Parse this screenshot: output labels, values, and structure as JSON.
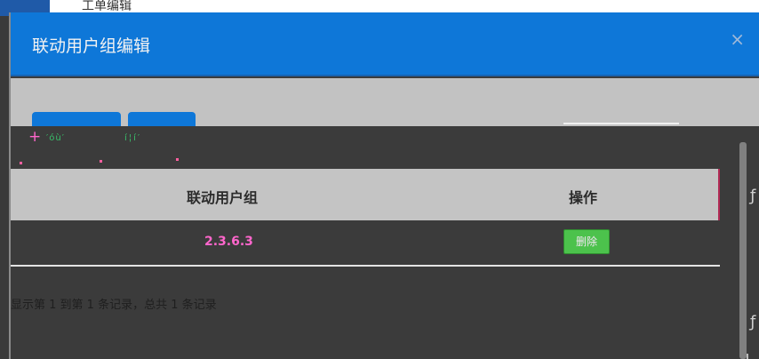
{
  "background_page": {
    "header_text": "工单编辑"
  },
  "dialog": {
    "title": "联动用户组编辑",
    "close_icon": "close-icon",
    "close_glyph": "×"
  },
  "toolbar_overlay": {
    "plus_glyph": "+",
    "text_1": "′óù′",
    "text_2": "í¦í′"
  },
  "table": {
    "columns": [
      "联动用户组",
      "操作"
    ],
    "rows": [
      {
        "group": "2.3.6.3",
        "action_label": "删除"
      }
    ]
  },
  "pagination": {
    "info": "显示第 1 到第 1 条记录，总共 1 条记录"
  },
  "side_edge": {
    "char_1": "ƒ",
    "char_2": "ƒ"
  },
  "colors": {
    "header_blue": "#0e77d8",
    "delete_green": "#4cc24c",
    "table_header_gray": "#c4c4c4",
    "highlight_pink": "#ff66cc"
  }
}
